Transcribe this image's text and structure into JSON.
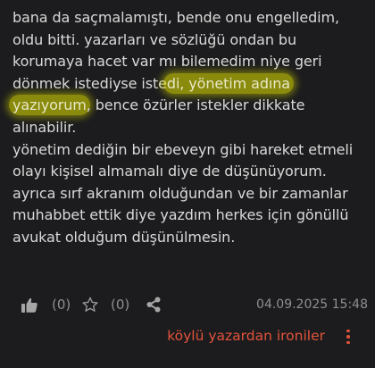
{
  "entry": {
    "lines": [
      "bana da saçmalamıştı, bende onu engelledim,",
      "oldu bitti. yazarları ve sözlüğü ondan bu",
      "korumaya hacet var mı bilemedim niye geri",
      "dönmek istediyse iste",
      "di, yönetim adına",
      "yazıyorum",
      ", bence özürler istekler dikkate",
      "alınabilir.",
      "yönetim dediğin bir ebeveyn gibi hareket etmeli",
      "olayı kişisel almamalı diye de düşünüyorum.",
      "ayrıca sırf akranım olduğundan ve bir zamanlar",
      "muhabbet ettik diye yazdım herkes için gönüllü",
      "avukat olduğum düşünülmesin."
    ]
  },
  "footer": {
    "upvote_count": "(0)",
    "favorite_count": "(0)",
    "date": "04.09.2025 15:48"
  },
  "author": {
    "name": "köylü yazardan ironiler"
  },
  "icons": {
    "upvote": "thumbs-up-icon",
    "favorite": "star-icon",
    "share": "share-icon",
    "more": "more-vertical-icon"
  },
  "colors": {
    "background": "#1c1c1e",
    "text": "#d9d9d9",
    "muted": "#8f8f8f",
    "accent": "#e2533a",
    "highlight": "#e6e600"
  }
}
